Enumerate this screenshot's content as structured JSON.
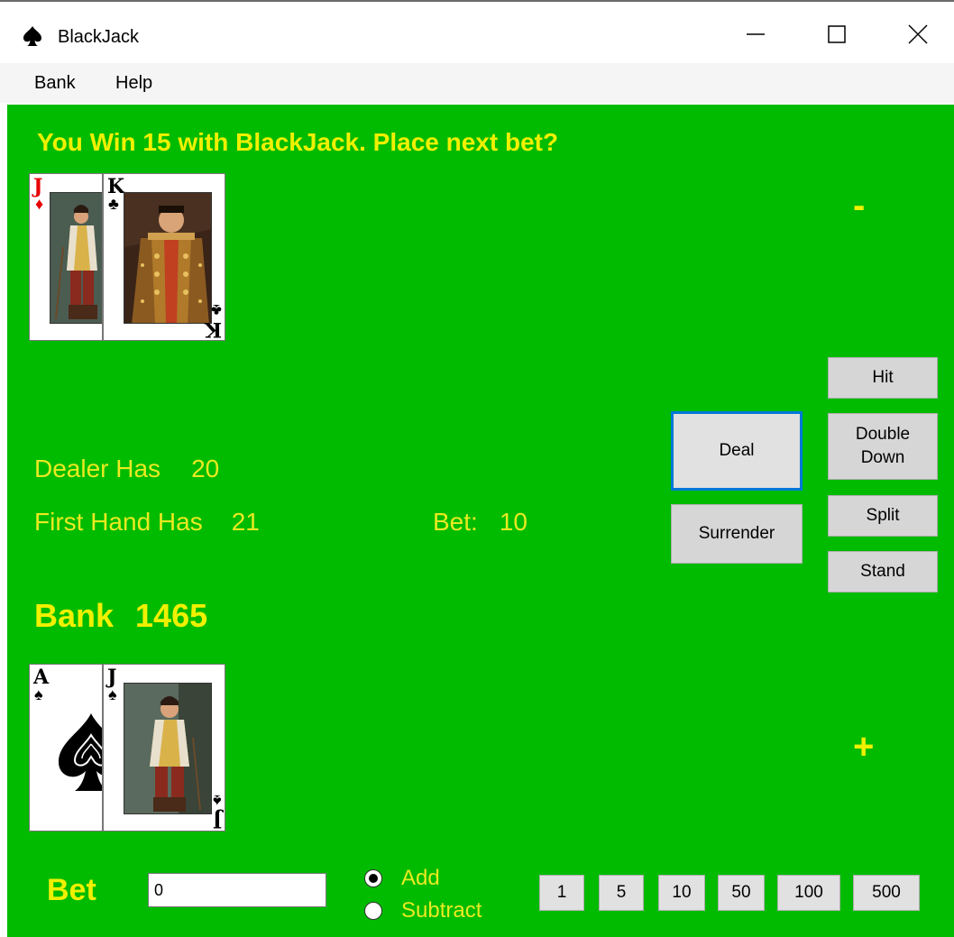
{
  "window": {
    "title": "BlackJack",
    "icon": "spade-icon",
    "controls": [
      "minimize-icon",
      "maximize-icon",
      "close-icon"
    ]
  },
  "menu": {
    "items": [
      "Bank",
      "Help"
    ]
  },
  "status_message": "You Win 15 with BlackJack. Place next bet?",
  "dealer": {
    "label": "Dealer Has",
    "value": "20",
    "cards": [
      {
        "rank": "J",
        "suit": "diamonds",
        "suit_glyph": "♦",
        "color": "#e60000"
      },
      {
        "rank": "K",
        "suit": "clubs",
        "suit_glyph": "♣",
        "color": "#000000"
      }
    ]
  },
  "player": {
    "label": "First Hand Has",
    "value": "21",
    "cards": [
      {
        "rank": "A",
        "suit": "spades",
        "suit_glyph": "♠",
        "color": "#000000"
      },
      {
        "rank": "J",
        "suit": "spades",
        "suit_glyph": "♠",
        "color": "#000000"
      }
    ]
  },
  "bet_display": {
    "label": "Bet:",
    "value": "10"
  },
  "bank": {
    "label": "Bank",
    "value": "1465"
  },
  "buttons": {
    "deal": "Deal",
    "surrender": "Surrender",
    "hit": "Hit",
    "double_down": "Double\nDown",
    "split": "Split",
    "stand": "Stand"
  },
  "minus": "-",
  "plus": "+",
  "bet_entry": {
    "label": "Bet",
    "value": "0",
    "mode_options": [
      {
        "label": "Add",
        "selected": true
      },
      {
        "label": "Subtract",
        "selected": false
      }
    ],
    "chips": [
      "1",
      "5",
      "10",
      "50",
      "100",
      "500"
    ]
  },
  "colors": {
    "table": "#00bb00",
    "text": "#f0f000",
    "focus": "#0078d7"
  }
}
